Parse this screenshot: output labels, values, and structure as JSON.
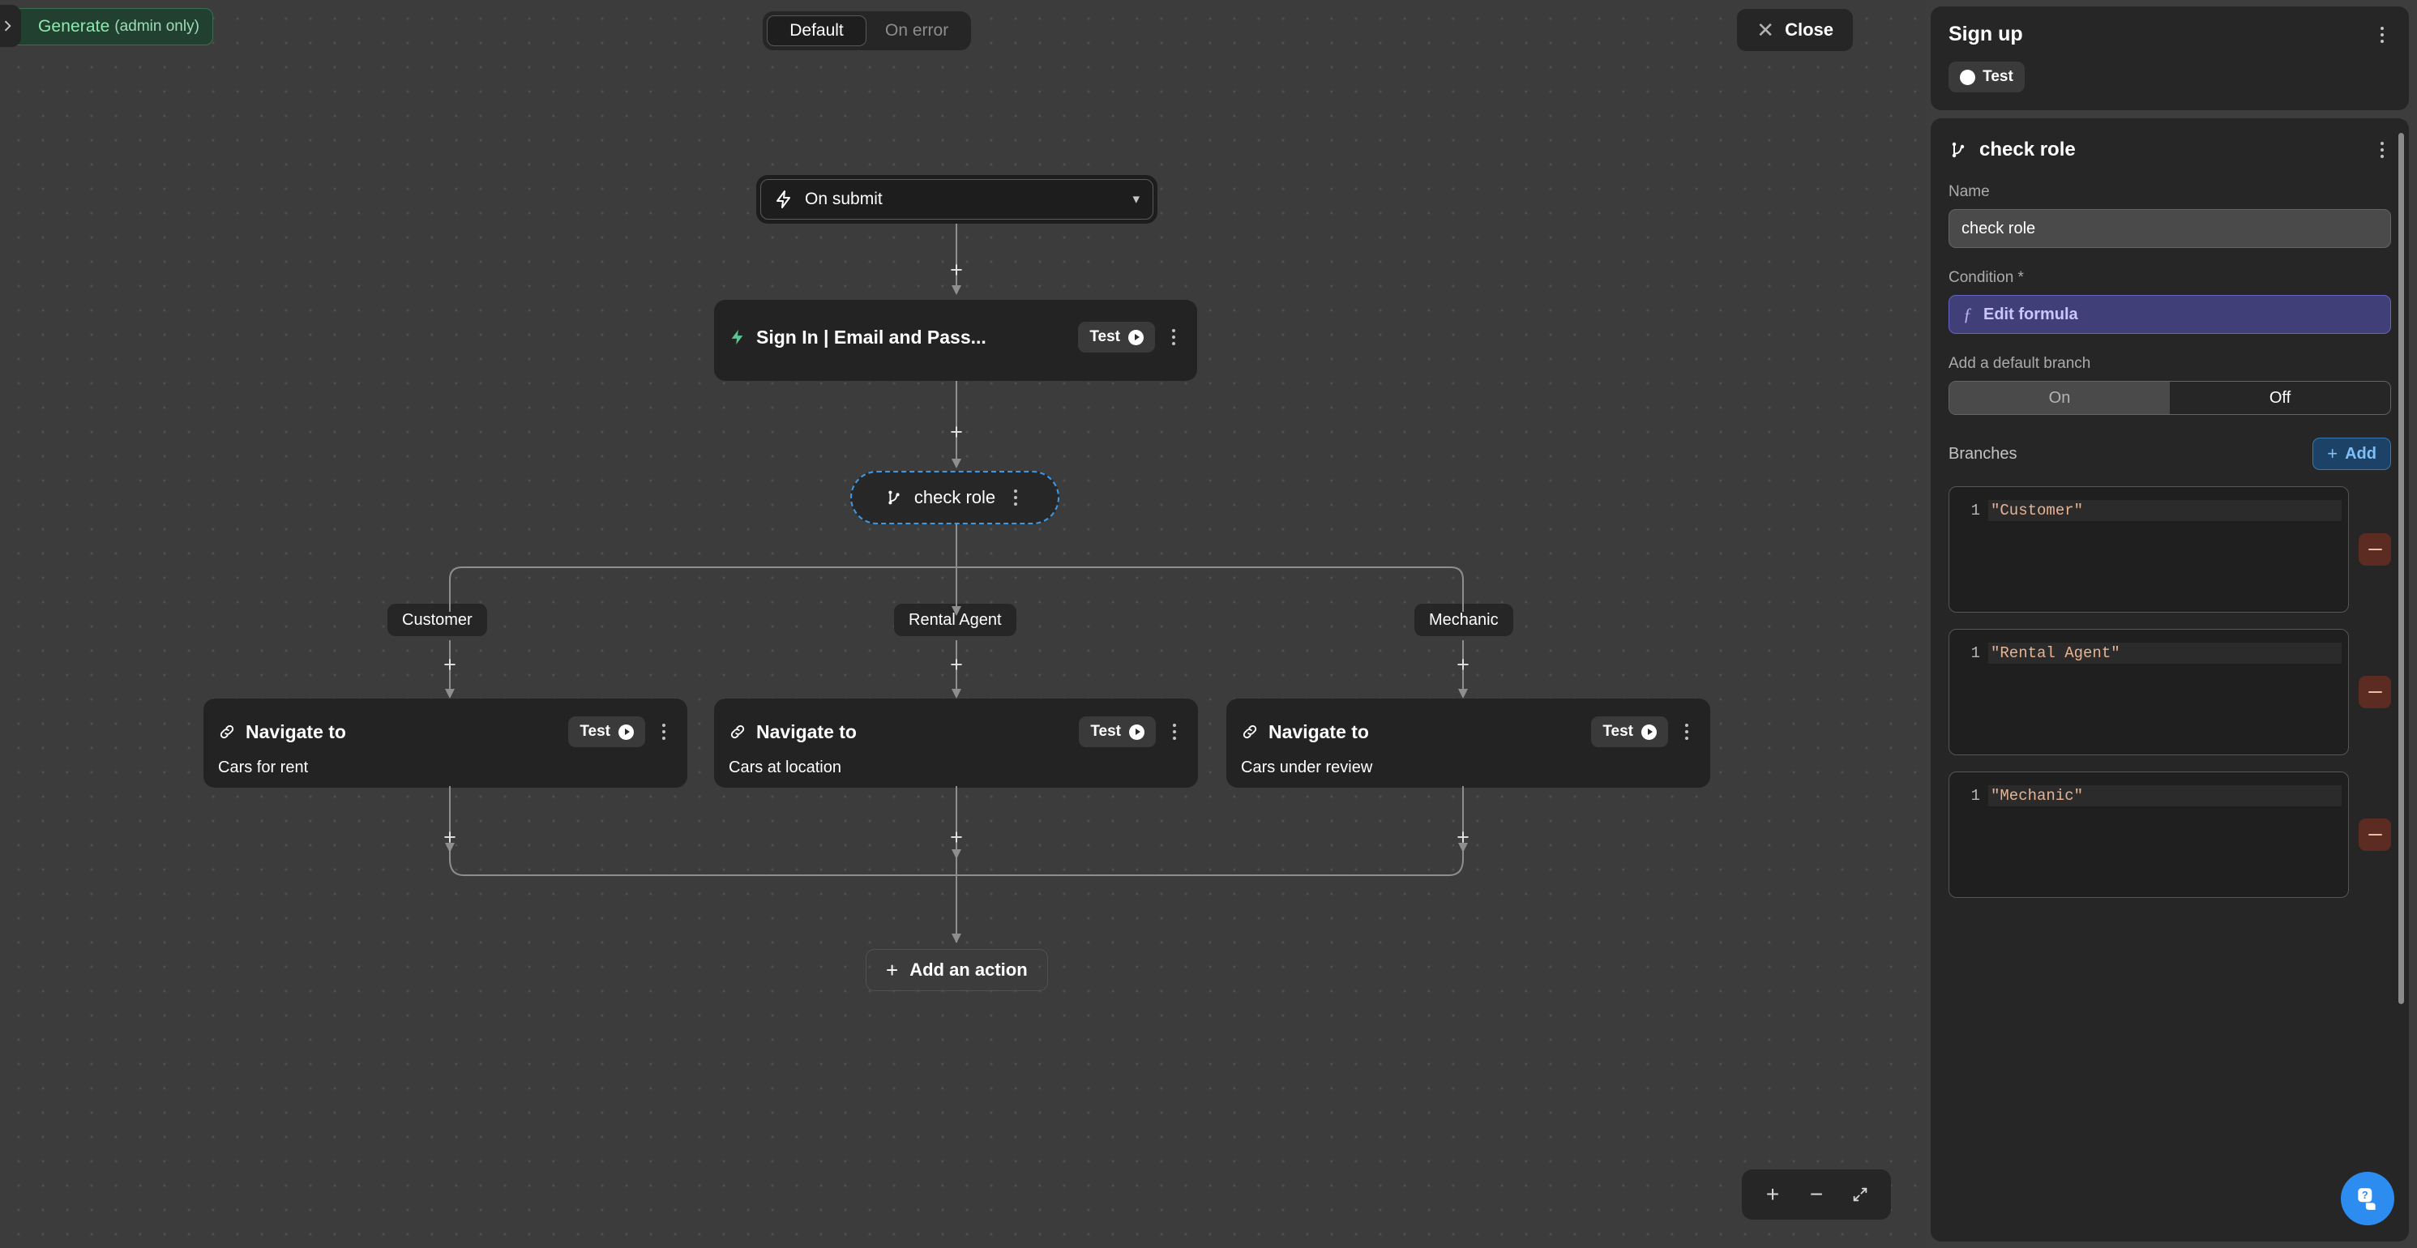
{
  "toolbar": {
    "collapse_icon": "chevron-right-icon",
    "generate_label": "Generate",
    "generate_sub": "(admin only)",
    "tabs": [
      {
        "label": "Default",
        "active": true
      },
      {
        "label": "On error",
        "active": false
      }
    ],
    "close_label": "Close",
    "close_icon": "close-icon"
  },
  "canvas": {
    "trigger": {
      "label": "On submit",
      "icon": "lightning-bolt-icon",
      "chevron": "chevron-down-icon"
    },
    "signin_node": {
      "title": "Sign In | Email and Pass...",
      "icon": "lightning-bolt-icon",
      "test_label": "Test"
    },
    "branch_node": {
      "label": "check role",
      "icon": "branch-icon"
    },
    "branch_chips": [
      {
        "label": "Customer"
      },
      {
        "label": "Rental Agent"
      },
      {
        "label": "Mechanic"
      }
    ],
    "navigate_nodes": [
      {
        "title": "Navigate to",
        "subtitle": "Cars for rent",
        "test_label": "Test",
        "icon": "link-icon"
      },
      {
        "title": "Navigate to",
        "subtitle": "Cars at location",
        "test_label": "Test",
        "icon": "link-icon"
      },
      {
        "title": "Navigate to",
        "subtitle": "Cars under review",
        "test_label": "Test",
        "icon": "link-icon"
      }
    ],
    "add_action_label": "Add an action",
    "plus_symbol": "+",
    "zoom_controls": {
      "zoom_in": "+",
      "zoom_out": "−",
      "fit_icon": "expand-icon"
    }
  },
  "right_panel": {
    "header": {
      "title": "Sign up",
      "test_label": "Test",
      "menu_icon": "kebab-menu-icon"
    },
    "node_panel": {
      "title": "check role",
      "icon": "branch-icon",
      "menu_icon": "kebab-menu-icon",
      "name_label": "Name",
      "name_value": "check role",
      "condition_label": "Condition *",
      "formula_label": "Edit formula",
      "formula_icon": "function-icon",
      "default_branch_label": "Add a default branch",
      "default_branch_options": [
        {
          "label": "On",
          "selected": false
        },
        {
          "label": "Off",
          "selected": true
        }
      ],
      "branches_label": "Branches",
      "add_label": "Add",
      "branches": [
        {
          "line_number": "1",
          "code": "\"Customer\""
        },
        {
          "line_number": "1",
          "code": "\"Rental Agent\""
        },
        {
          "line_number": "1",
          "code": "\"Mechanic\""
        }
      ]
    }
  },
  "help": {
    "icon": "help-chat-icon"
  },
  "colors": {
    "accent_blue": "#3b9ae8",
    "formula_purple": "#413f77",
    "add_blue": "#1d4268",
    "remove_red": "#5c2c22",
    "generate_green": "#22402f",
    "code_string": "#e7b393"
  }
}
